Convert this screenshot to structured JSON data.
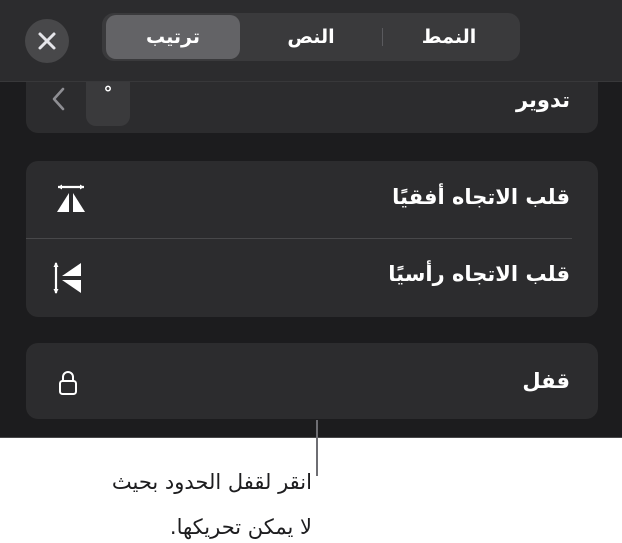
{
  "header": {
    "close_icon": "close-icon",
    "tabs": [
      {
        "label": "ترتيب",
        "selected": true
      },
      {
        "label": "النص",
        "selected": false
      },
      {
        "label": "النمط",
        "selected": false
      }
    ]
  },
  "rotate": {
    "label": "تدوير",
    "value": "°",
    "chevron_icon": "chevron-left-icon"
  },
  "flip": {
    "horizontal_label": "قلب الاتجاه أفقيًا",
    "horizontal_icon": "flip-horizontal-icon",
    "vertical_label": "قلب الاتجاه رأسيًا",
    "vertical_icon": "flip-vertical-icon"
  },
  "lock": {
    "label": "قفل",
    "icon": "lock-icon"
  },
  "caption": {
    "line1": "انقر لقفل الحدود بحيث",
    "line2": "لا يمكن تحريكها."
  },
  "colors": {
    "panel_bg": "#1c1c1e",
    "card_bg": "#2c2c2e",
    "selected_tab": "#636366",
    "text": "#ffffff",
    "caption_text": "#1d1d1f"
  }
}
